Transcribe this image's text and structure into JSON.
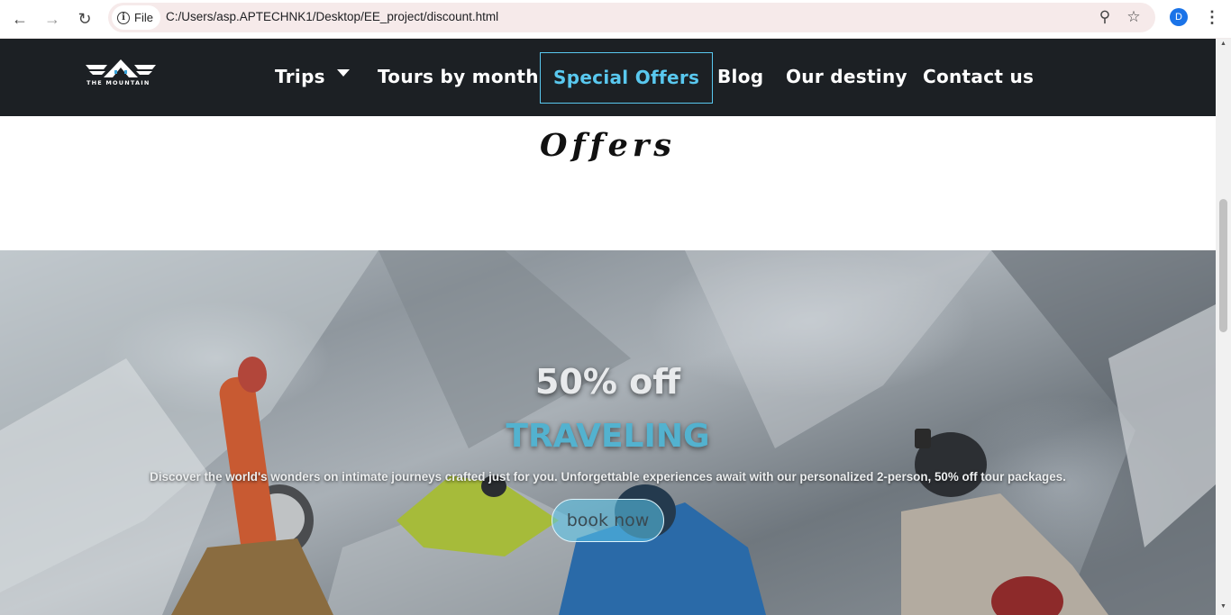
{
  "browser": {
    "file_label": "File",
    "url": "C:/Users/asp.APTECHNK1/Desktop/EE_project/discount.html",
    "avatar_letter": "D",
    "icons": [
      "back-icon",
      "forward-icon",
      "reload-icon",
      "info-icon",
      "zoom-icon",
      "star-icon",
      "kebab-menu-icon"
    ]
  },
  "site": {
    "logo_text": "THE MOUNTAIN",
    "menu": [
      {
        "label": "Trips",
        "has_dropdown": true
      },
      {
        "label": "Tours by month"
      },
      {
        "label": "Special Offers",
        "active": true
      },
      {
        "label": "Blog"
      },
      {
        "label": "Our destiny"
      },
      {
        "label": "Contact us"
      }
    ],
    "accent_color": "#59c8ef",
    "nav_bg": "#1c2024"
  },
  "page": {
    "heading": "Offers",
    "hero": {
      "discount": "50% off",
      "headline": "TRAVELING",
      "description": "Discover the world's wonders on intimate journeys crafted just for you. Unforgettable experiences await with our personalized 2-person, 50% off tour packages.",
      "button": "book now"
    }
  }
}
